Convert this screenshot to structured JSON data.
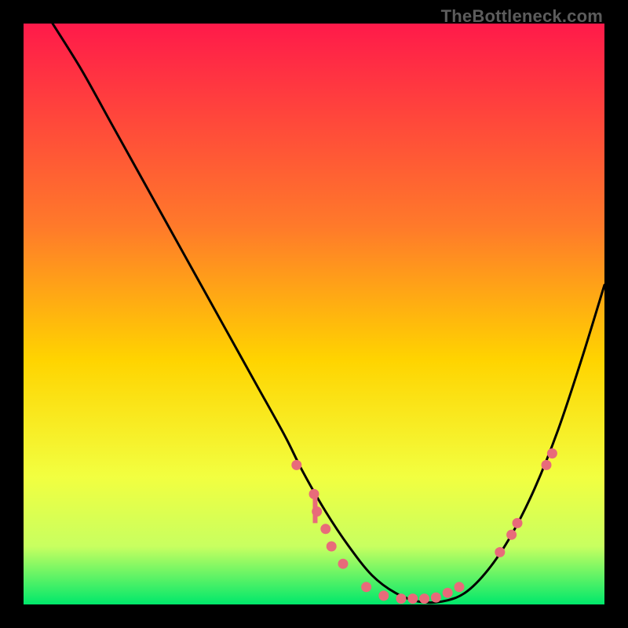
{
  "watermark": "TheBottleneck.com",
  "gradient": {
    "top": "#ff1a4a",
    "mid1": "#ff7a2a",
    "mid2": "#ffd400",
    "mid3": "#f2ff40",
    "mid4": "#c8ff60",
    "bottom": "#00e86b"
  },
  "chart_data": {
    "type": "line",
    "title": "",
    "xlabel": "",
    "ylabel": "",
    "xlim": [
      0,
      100
    ],
    "ylim": [
      0,
      100
    ],
    "series": [
      {
        "name": "curve",
        "x": [
          5,
          10,
          15,
          20,
          25,
          30,
          35,
          40,
          45,
          48,
          52,
          56,
          60,
          64,
          68,
          72,
          76,
          80,
          84,
          88,
          92,
          96,
          100
        ],
        "y": [
          100,
          92,
          83,
          74,
          65,
          56,
          47,
          38,
          29,
          23,
          16,
          10,
          5,
          2,
          0.5,
          0.5,
          2,
          6,
          12,
          20,
          30,
          42,
          55
        ]
      }
    ],
    "scatter": [
      {
        "name": "pink-dots",
        "color": "#e86b7a",
        "points": [
          {
            "x": 47,
            "y": 24
          },
          {
            "x": 50,
            "y": 19
          },
          {
            "x": 50.5,
            "y": 16
          },
          {
            "x": 52,
            "y": 13
          },
          {
            "x": 53,
            "y": 10
          },
          {
            "x": 55,
            "y": 7
          },
          {
            "x": 59,
            "y": 3
          },
          {
            "x": 62,
            "y": 1.5
          },
          {
            "x": 65,
            "y": 1
          },
          {
            "x": 67,
            "y": 1
          },
          {
            "x": 69,
            "y": 1
          },
          {
            "x": 71,
            "y": 1.2
          },
          {
            "x": 73,
            "y": 2
          },
          {
            "x": 75,
            "y": 3
          },
          {
            "x": 82,
            "y": 9
          },
          {
            "x": 84,
            "y": 12
          },
          {
            "x": 85,
            "y": 14
          },
          {
            "x": 90,
            "y": 24
          },
          {
            "x": 91,
            "y": 26
          }
        ]
      }
    ],
    "bar_segment": {
      "x": 50.2,
      "y_top": 19,
      "y_bottom": 14
    }
  }
}
